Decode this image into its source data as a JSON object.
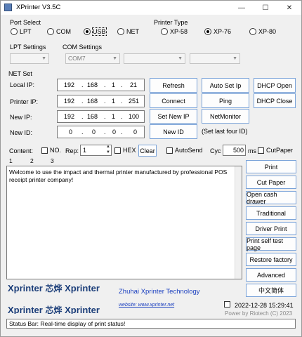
{
  "window": {
    "title": "XPrinter V3.5C",
    "minimize": "—",
    "maximize": "☐",
    "close": "✕"
  },
  "port_select": {
    "label": "Port Select",
    "options": [
      "LPT",
      "COM",
      "USB",
      "NET"
    ],
    "selected": "USB"
  },
  "printer_type": {
    "label": "Printer Type",
    "options": [
      "XP-58",
      "XP-76",
      "XP-80"
    ],
    "selected": "XP-76"
  },
  "lpt_settings": {
    "label": "LPT Settings",
    "value": ""
  },
  "com_settings": {
    "label": "COM Settings",
    "port": "COM7",
    "baud": "",
    "extra": ""
  },
  "net_set": {
    "label": "NET Set",
    "rows": [
      {
        "label": "Local IP:",
        "octets": [
          "192",
          "168",
          "1",
          "21"
        ]
      },
      {
        "label": "Printer IP:",
        "octets": [
          "192",
          "168",
          "1",
          "251"
        ]
      },
      {
        "label": "New IP:",
        "octets": [
          "192",
          "168",
          "1",
          "100"
        ]
      },
      {
        "label": "New ID:",
        "octets": [
          "0",
          "0",
          "0",
          "0"
        ]
      }
    ],
    "buttons": {
      "refresh": "Refresh",
      "auto_set_ip": "Auto Set Ip",
      "dhcp_open": "DHCP Open",
      "connect": "Connect",
      "ping": "Ping",
      "dhcp_close": "DHCP Close",
      "set_new_ip": "Set New IP",
      "netmonitor": "NetMonitor",
      "new_id": "New ID"
    },
    "hint": "(Set last four ID)"
  },
  "content": {
    "label": "Content:",
    "no_label": "NO.",
    "rep_label": "Rep:",
    "rep_value": "1",
    "hex_label": "HEX",
    "clear": "Clear",
    "autosend": "AutoSend",
    "cyc_label": "Cyc",
    "cyc_value": "500",
    "ms_label": "ms",
    "cutpaper_label": "CutPaper",
    "tabs": [
      "1",
      "2",
      "3"
    ],
    "text": "Welcome to use the impact and thermal printer manufactured by professional POS receipt printer company!"
  },
  "actions": [
    "Print",
    "Cut Paper",
    "Open cash drawer",
    "Traditional",
    "Driver Print",
    "Print self test page",
    "Restore factory",
    "Advanced",
    "中文简体"
  ],
  "brand": {
    "logo_text": "Xprinter",
    "logo_cn": "芯烨",
    "company": "Zhuhai Xprinter Technology",
    "website": "website: www.xprinter.net",
    "datetime": "2022-12-28 15:29:41",
    "powered": "Power by Riotech (C) 2023"
  },
  "status_bar": "Status Bar: Real-time display of print status!",
  "colors": {
    "button_border": "#7aa3d9",
    "window_bg": "#f0f0f0",
    "logo": "#1d3f7a",
    "link": "#1a3fbf"
  }
}
